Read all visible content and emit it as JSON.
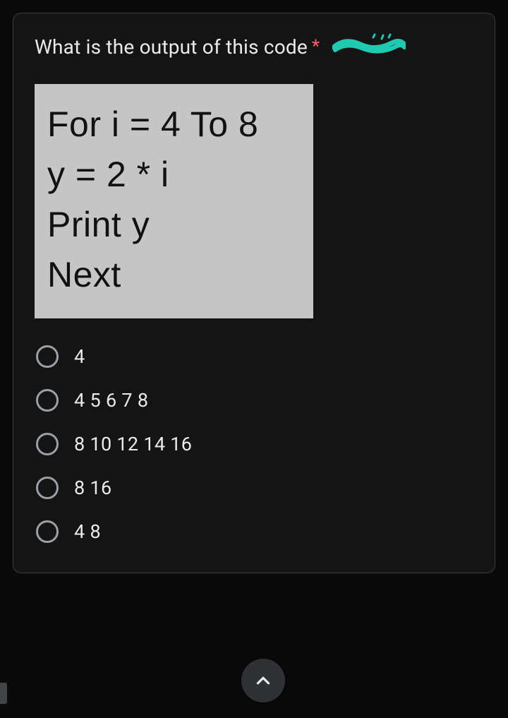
{
  "question": {
    "text": "What is the output of this code",
    "required_marker": "*"
  },
  "code": {
    "lines": [
      "For i = 4 To 8",
      "y = 2 * i",
      "Print y",
      "Next"
    ]
  },
  "options": [
    {
      "label": "4"
    },
    {
      "label": "4 5 6 7 8"
    },
    {
      "label": "8 10 12 14 16"
    },
    {
      "label": "8 16"
    },
    {
      "label": "4 8"
    }
  ],
  "icons": {
    "chevron_up": "chevron-up-icon"
  }
}
